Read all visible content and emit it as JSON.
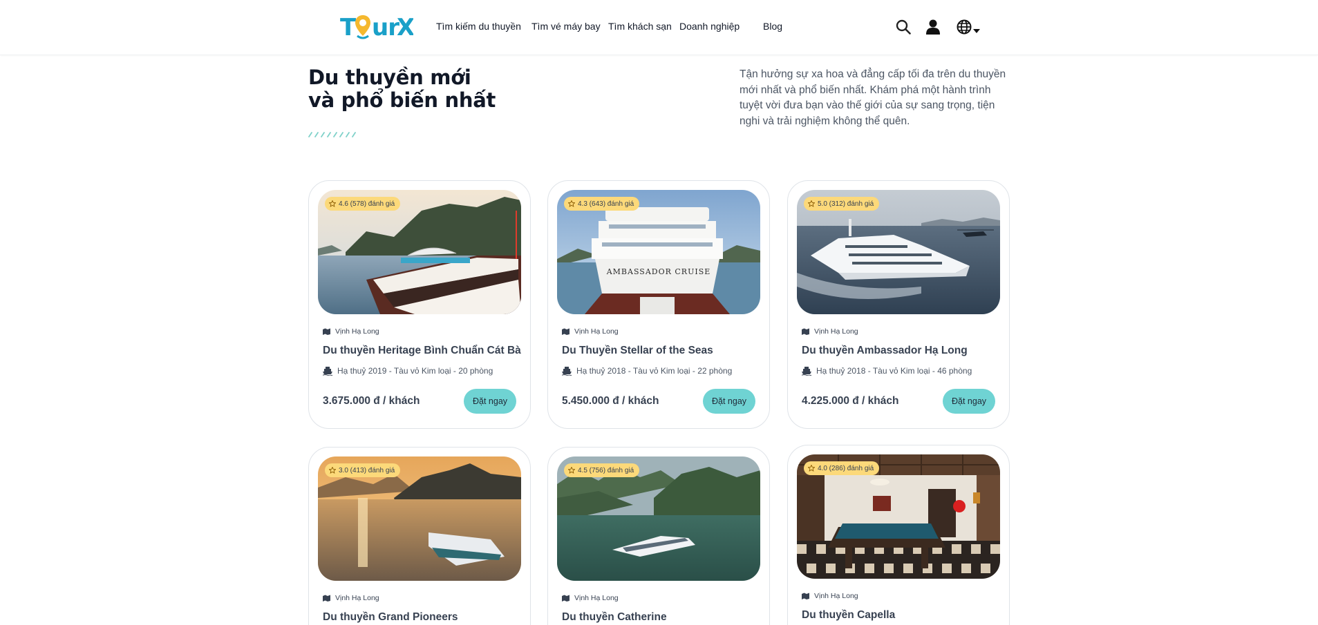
{
  "header": {
    "logo_text": "TourX",
    "nav": [
      {
        "label": "Tìm kiếm du thuyền"
      },
      {
        "label": "Tìm vé máy bay"
      },
      {
        "label": "Tìm khách sạn"
      },
      {
        "label": "Doanh nghiệp"
      },
      {
        "label": "Blog"
      }
    ],
    "icons": [
      "search-icon",
      "user-icon",
      "globe-icon",
      "caret-down-icon"
    ]
  },
  "section": {
    "title_line1": "Du thuyền mới",
    "title_line2": "và phổ biến nhất",
    "description": "Tận hưởng sự xa hoa và đẳng cấp tối đa trên du thuyền mới nhất và phổ biến nhất. Khám phá một hành trình tuyệt vời đưa bạn vào thế giới của sự sang trọng, tiện nghi và trải nghiệm không thể quên."
  },
  "colors": {
    "brand_teal": "#1aa0c8",
    "button": "#6fd3d3",
    "badge": "#fcd97a"
  },
  "cards": [
    {
      "rating": "4.6 (578) đánh giá",
      "location": "Vịnh Hạ Long",
      "name": "Du thuyền Heritage Bình Chuẩn Cát Bà",
      "spec": "Hạ thuỷ 2019 - Tàu vỏ Kim loại - 20 phòng",
      "price": "3.675.000 đ / khách",
      "button": "Đặt ngay"
    },
    {
      "rating": "4.3 (643) đánh giá",
      "location": "Vịnh Hạ Long",
      "name": "Du Thuyền Stellar of the Seas",
      "spec": "Hạ thuỷ 2018 - Tàu vỏ Kim loại - 22 phòng",
      "price": "5.450.000 đ / khách",
      "button": "Đặt ngay",
      "image_text": "AMBASSADOR CRUISE"
    },
    {
      "rating": "5.0 (312) đánh giá",
      "location": "Vịnh Hạ Long",
      "name": "Du thuyền Ambassador Hạ Long",
      "spec": "Hạ thuỷ 2018 - Tàu vỏ Kim loại - 46 phòng",
      "price": "4.225.000 đ / khách",
      "button": "Đặt ngay"
    },
    {
      "rating": "3.0 (413) đánh giá",
      "location": "Vịnh Hạ Long",
      "name": "Du thuyền Grand Pioneers"
    },
    {
      "rating": "4.5 (756) đánh giá",
      "location": "Vịnh Hạ Long",
      "name": "Du thuyền Catherine"
    },
    {
      "rating": "4.0 (286) đánh giá",
      "location": "Vịnh Hạ Long",
      "name": "Du thuyền Capella"
    }
  ]
}
